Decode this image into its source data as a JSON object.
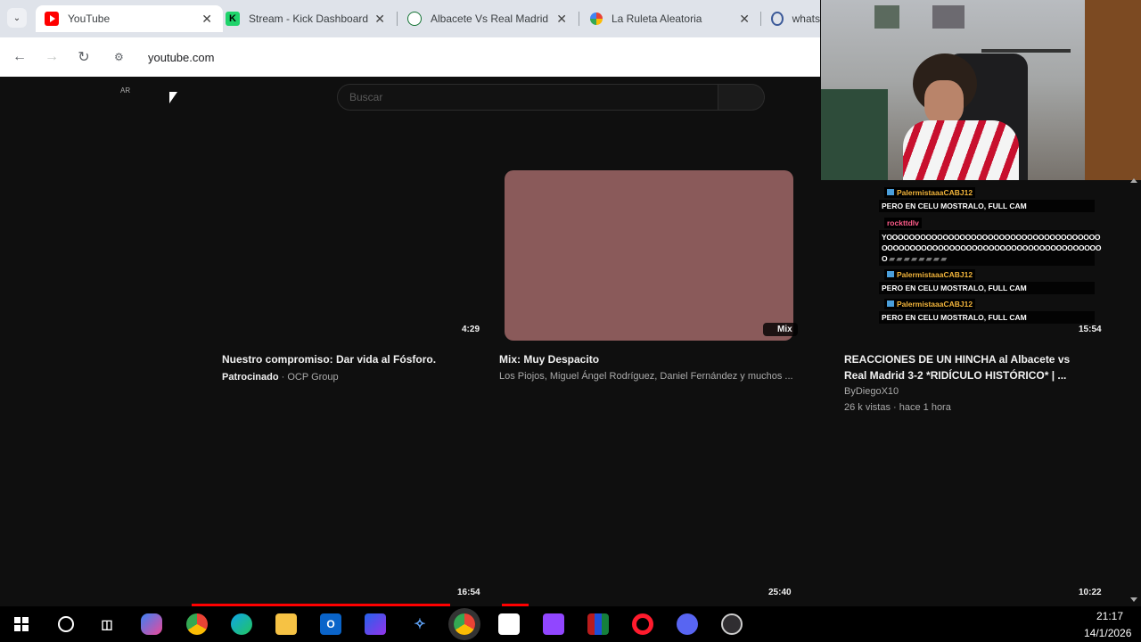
{
  "browser": {
    "tabs": [
      {
        "title": "YouTube",
        "active": true
      },
      {
        "title": "Stream - Kick Dashboard"
      },
      {
        "title": "Albacete Vs Real Madrid"
      },
      {
        "title": "La Ruleta Aleatoria"
      },
      {
        "title": "whats"
      }
    ],
    "url": "youtube.com"
  },
  "youtube": {
    "country_code": "AR",
    "search_placeholder": "Buscar",
    "videos": [
      {
        "duration": "4:29",
        "title": "Nuestro compromiso: Dar vida al Fósforo.",
        "sponsored_label": "Patrocinado",
        "channel": "OCP Group"
      },
      {
        "duration_badge": "Mix",
        "title": "Mix: Muy Despacito",
        "channel": "Los Piojos, Miguel Ángel Rodríguez, Daniel Fernández y muchos ..."
      },
      {
        "duration": "15:54",
        "title_line1": "REACCIONES DE UN HINCHA al Albacete vs",
        "title_line2": "Real Madrid 3-2 *RIDÍCULO HISTÓRICO* | ...",
        "channel": "ByDiegoX10",
        "stats": "26 k vistas · hace 1 hora"
      }
    ],
    "bottom_durations": [
      "16:54",
      "25:40",
      "10:22"
    ]
  },
  "chat": [
    {
      "user": "PalermistaaaCABJ12",
      "message": "PERO EN CELU MOSTRALO, FULL CAM"
    },
    {
      "user": "rockttdlv",
      "message_line1": "YOOOOOOOOOOOOOOOOOOOOOOOOOOOOOOOOOOOOOO",
      "message_line2": "OOOOOOOOOOOOOOOOOOOOOOOOOOOOOOOOOOOOOOO",
      "message_line3": "O"
    },
    {
      "user": "PalermistaaaCABJ12",
      "message": "PERO EN CELU MOSTRALO, FULL CAM"
    },
    {
      "user": "PalermistaaaCABJ12",
      "message": "PERO EN CELU MOSTRALO, FULL CAM"
    }
  ],
  "taskbar": {
    "time": "21:17",
    "date": "14/1/2026"
  },
  "colors": {
    "youtube_red": "#ff0000",
    "mix_thumbnail": "#8a5a5a",
    "chat_user_gold": "#f3b53b",
    "chat_user_pink": "#ff5c8a"
  }
}
